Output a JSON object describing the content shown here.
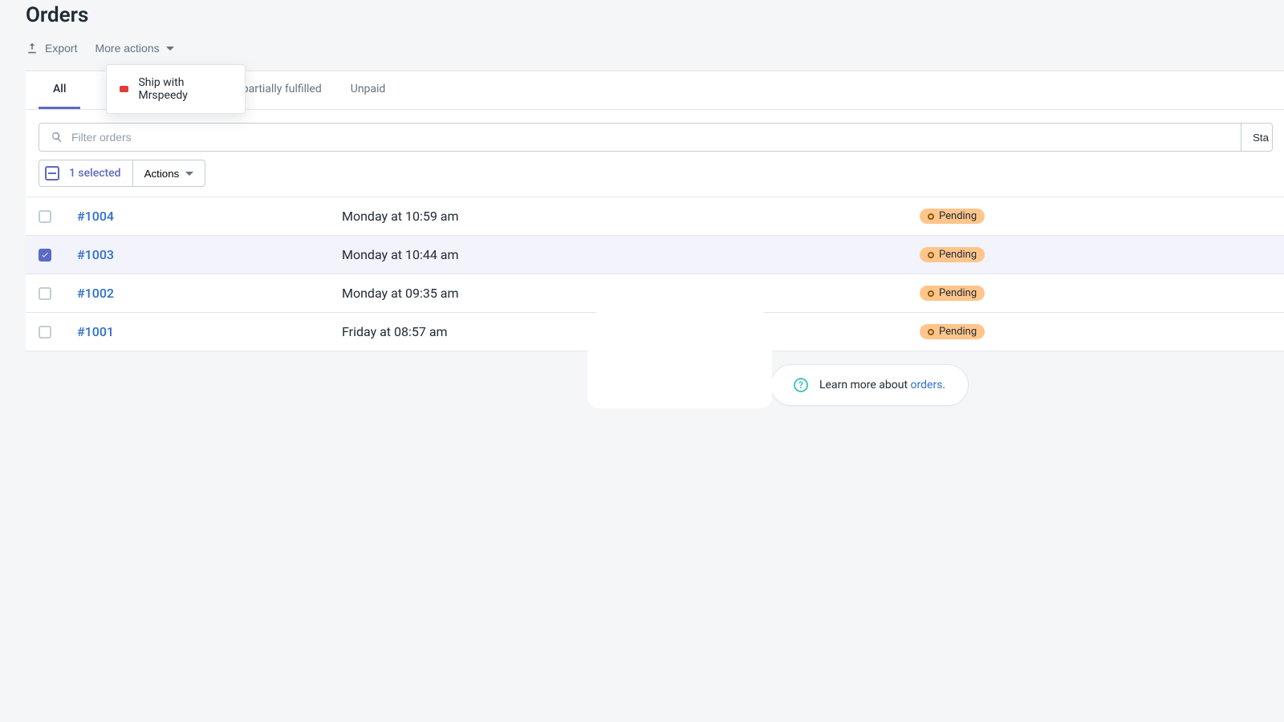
{
  "page": {
    "title": "Orders"
  },
  "toolbar": {
    "export_label": "Export",
    "more_actions_label": "More actions"
  },
  "dropdown": {
    "item_label": "Ship with Mrspeedy"
  },
  "tabs": {
    "all": "All",
    "partial": "d partially fulfilled",
    "unpaid": "Unpaid"
  },
  "search": {
    "placeholder": "Filter orders"
  },
  "status_filter": {
    "label": "Sta"
  },
  "selection": {
    "count_label": "1 selected",
    "actions_label": "Actions"
  },
  "orders": [
    {
      "id": "#1004",
      "date": "Monday at 10:59 am",
      "status": "Pending",
      "selected": false
    },
    {
      "id": "#1003",
      "date": "Monday at 10:44 am",
      "status": "Pending",
      "selected": true
    },
    {
      "id": "#1002",
      "date": "Monday at 09:35 am",
      "status": "Pending",
      "selected": false
    },
    {
      "id": "#1001",
      "date": "Friday at 08:57 am",
      "status": "Pending",
      "selected": false
    }
  ],
  "learn": {
    "prefix": "Learn more about ",
    "link": "orders",
    "suffix": "."
  }
}
